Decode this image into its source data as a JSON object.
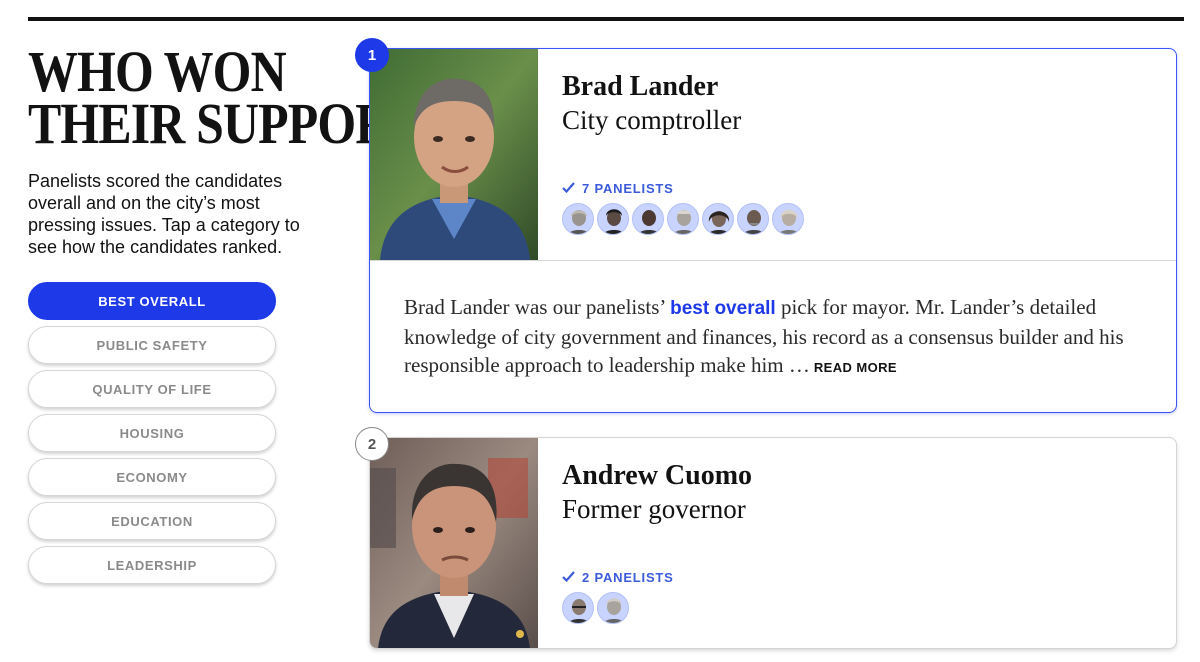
{
  "headline": {
    "line1": "WHO WON",
    "line2": "THEIR SUPPORT"
  },
  "intro": "Panelists scored the candidates overall and on the city’s most pressing issues. Tap a category to see how the candidates ranked.",
  "categories": [
    {
      "label": "BEST OVERALL",
      "active": true
    },
    {
      "label": "PUBLIC SAFETY",
      "active": false
    },
    {
      "label": "QUALITY OF LIFE",
      "active": false
    },
    {
      "label": "HOUSING",
      "active": false
    },
    {
      "label": "ECONOMY",
      "active": false
    },
    {
      "label": "EDUCATION",
      "active": false
    },
    {
      "label": "LEADERSHIP",
      "active": false
    }
  ],
  "candidates": [
    {
      "rank": "1",
      "name": "Brad Lander",
      "title": "City comptroller",
      "panelists_label": "7 PANELISTS",
      "panelist_count": 7,
      "blurb_before": "Brad Lander was our panelists’ ",
      "blurb_highlight": "best overall",
      "blurb_after": " pick for mayor. Mr. Lander’s detailed knowledge of city government and finances, his record as a consensus builder and his responsible approach to leadership make him …",
      "read_more": "READ MORE"
    },
    {
      "rank": "2",
      "name": "Andrew Cuomo",
      "title": "Former governor",
      "panelists_label": "2 PANELISTS",
      "panelist_count": 2
    }
  ],
  "colors": {
    "accent": "#1d39e8",
    "panelist_text": "#3b5bdb",
    "avatar_bg": "#c8d3ff"
  },
  "icons": {
    "checkmark": "check-icon"
  }
}
